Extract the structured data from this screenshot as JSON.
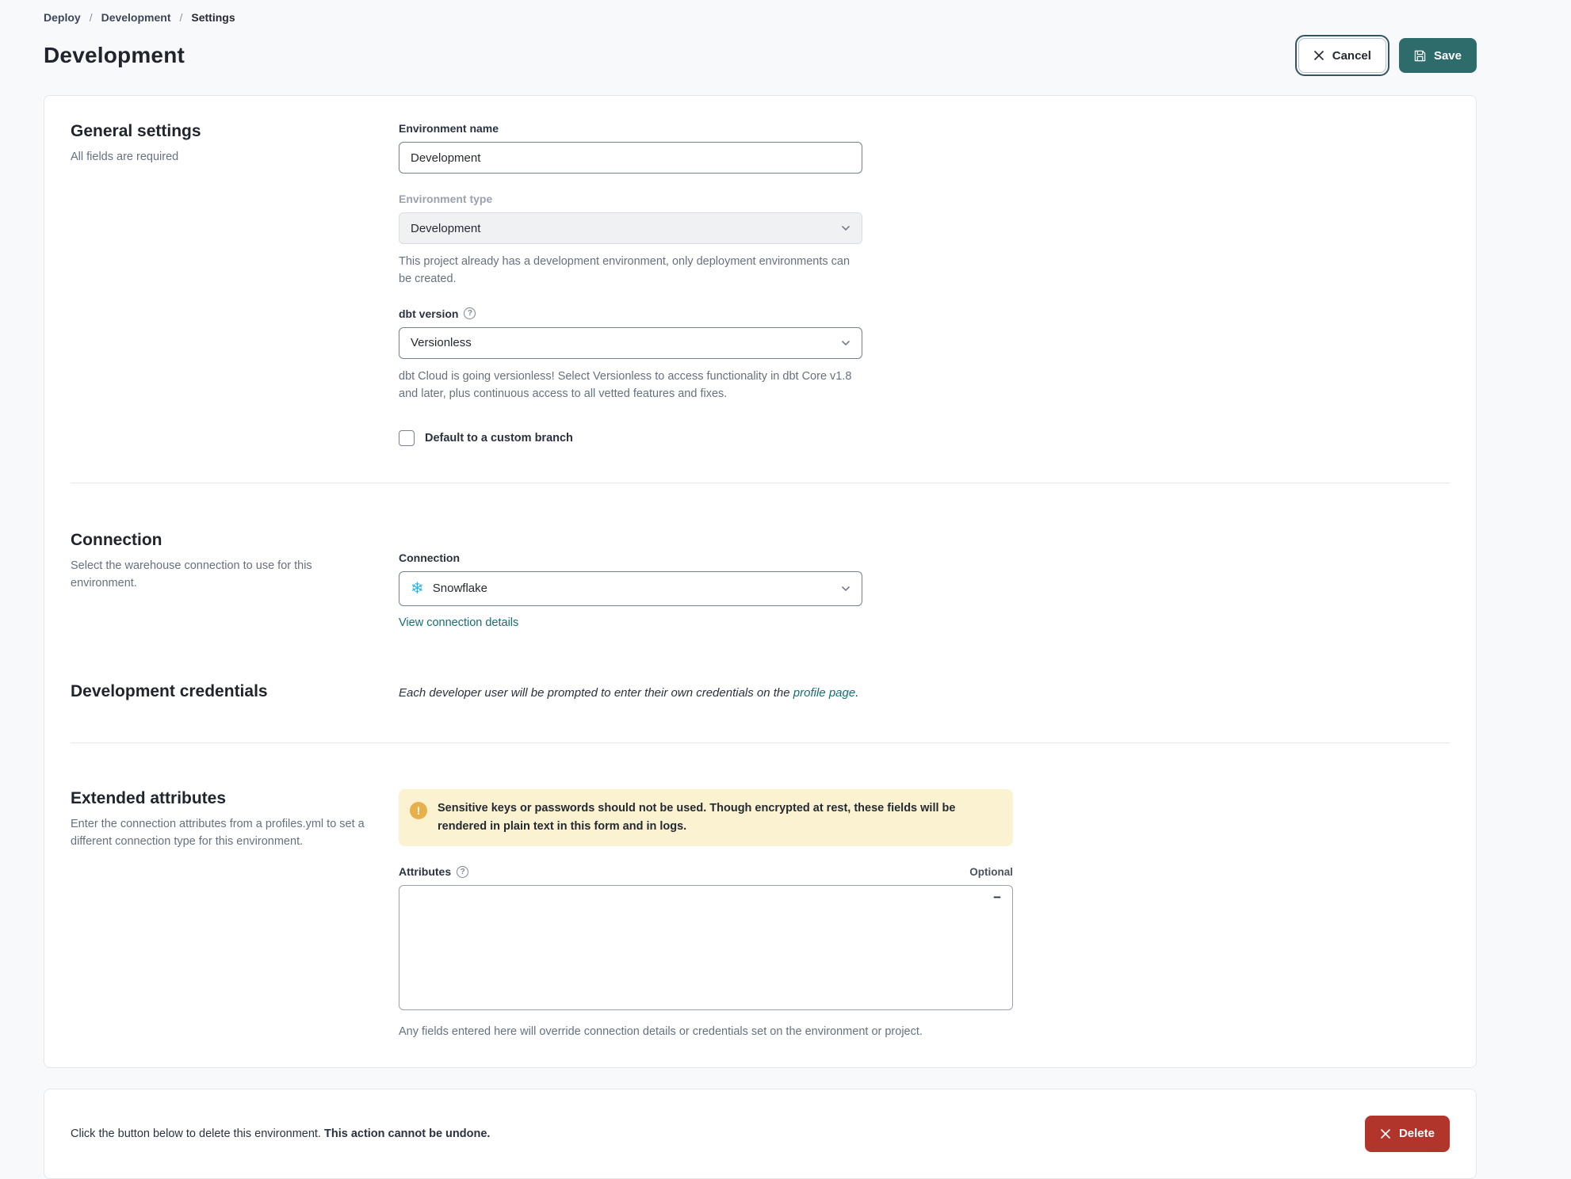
{
  "breadcrumb": {
    "items": [
      "Deploy",
      "Development",
      "Settings"
    ],
    "separator": "/"
  },
  "header": {
    "title": "Development",
    "cancel_label": "Cancel",
    "save_label": "Save"
  },
  "general": {
    "heading": "General settings",
    "subheading": "All fields are required",
    "env_name": {
      "label": "Environment name",
      "value": "Development"
    },
    "env_type": {
      "label": "Environment type",
      "value": "Development",
      "help": "This project already has a development environment, only deployment environments can be created."
    },
    "dbt_version": {
      "label": "dbt version",
      "value": "Versionless",
      "help": "dbt Cloud is going versionless! Select Versionless to access functionality in dbt Core v1.8 and later, plus continuous access to all vetted features and fixes."
    },
    "custom_branch": {
      "label": "Default to a custom branch",
      "checked": false
    }
  },
  "connection": {
    "heading": "Connection",
    "subheading": "Select the warehouse connection to use for this environment.",
    "field_label": "Connection",
    "value": "Snowflake",
    "snowflake_icon": "❄",
    "details_link": "View connection details"
  },
  "credentials": {
    "heading": "Development credentials",
    "text_before": "Each developer user will be prompted to enter their own credentials on the ",
    "link_text": "profile page",
    "text_after": "."
  },
  "extended": {
    "heading": "Extended attributes",
    "subheading": "Enter the connection attributes from a profiles.yml to set a different connection type for this environment.",
    "warning": "Sensitive keys or passwords should not be used. Though encrypted at rest, these fields will be rendered in plain text in this form and in logs.",
    "warning_glyph": "!",
    "attributes_label": "Attributes",
    "optional_label": "Optional",
    "attributes_value": "",
    "fold_glyph": "−",
    "helper": "Any fields entered here will override connection details or credentials set on the environment or project."
  },
  "danger": {
    "text": "Click the button below to delete this environment. ",
    "text_bold": "This action cannot be undone.",
    "delete_label": "Delete"
  },
  "colors": {
    "accent_teal": "#2E6C6C",
    "link_teal": "#156E72",
    "danger_red": "#B2352C",
    "warning_bg": "#FAF2D0",
    "warning_icon": "#E8B04B",
    "snowflake_blue": "#29B5E8",
    "page_bg": "#F8F9FB",
    "card_border": "#E4E7EB"
  }
}
